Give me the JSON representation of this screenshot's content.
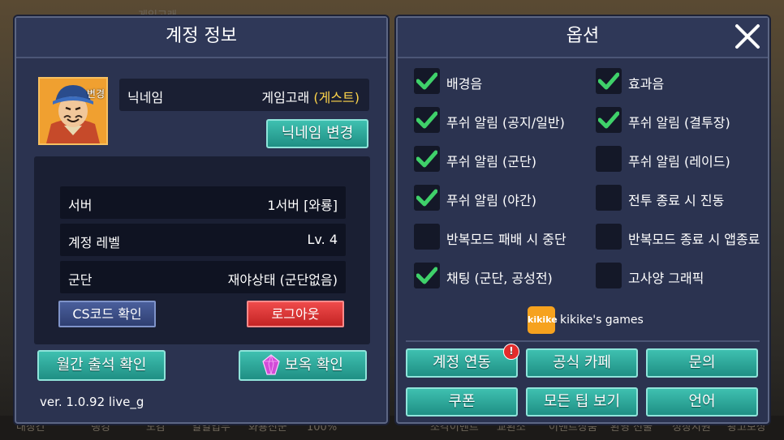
{
  "background": {
    "top_label": "게임고래",
    "nav_items": [
      "대장간",
      "랭킹",
      "도감",
      "일일업무",
      "화룡진군",
      "100%",
      "조각이벤트",
      "교환소",
      "이벤트상품",
      "환영 선물",
      "성장지원",
      "광고보상"
    ]
  },
  "account": {
    "title": "계정 정보",
    "avatar_change_label": "변경",
    "nickname_label": "닉네임",
    "nickname_value": "게임고래",
    "guest_tag": "(게스트)",
    "nickname_change_button": "닉네임 변경",
    "rows": [
      {
        "label": "서버",
        "value": "1서버 [와룡]"
      },
      {
        "label": "계정 레벨",
        "value": "Lv. 4"
      },
      {
        "label": "군단",
        "value": "재야상태 (군단없음)"
      }
    ],
    "cs_button": "CS코드 확인",
    "logout_button": "로그아웃",
    "monthly_button": "월간 출석 확인",
    "gem_button": "보옥 확인",
    "version": "ver. 1.0.92 live_g"
  },
  "options": {
    "title": "옵션",
    "items": [
      {
        "label": "배경음",
        "checked": true
      },
      {
        "label": "효과음",
        "checked": true
      },
      {
        "label": "푸쉬 알림 (공지/일반)",
        "checked": true
      },
      {
        "label": "푸쉬 알림 (결투장)",
        "checked": true
      },
      {
        "label": "푸쉬 알림 (군단)",
        "checked": true
      },
      {
        "label": "푸쉬 알림 (레이드)",
        "checked": false
      },
      {
        "label": "푸쉬 알림 (야간)",
        "checked": true
      },
      {
        "label": "전투 종료 시 진동",
        "checked": false
      },
      {
        "label": "반복모드 패배 시 중단",
        "checked": false
      },
      {
        "label": "반복모드 종료 시 앱종료",
        "checked": false
      },
      {
        "label": "채팅 (군단, 공성전)",
        "checked": true
      },
      {
        "label": "고사양 그래픽",
        "checked": false
      }
    ],
    "brand_logo": "kikike",
    "brand_name": "kikike's games",
    "buttons": [
      "계정 연동",
      "공식 카페",
      "문의",
      "쿠폰",
      "모든 팁 보기",
      "언어"
    ],
    "alert_badge": "!"
  },
  "colors": {
    "accent_teal": "#2fae9f",
    "check_green": "#3fd16a",
    "guest_yellow": "#ffd54a",
    "logout_red": "#d93434"
  }
}
